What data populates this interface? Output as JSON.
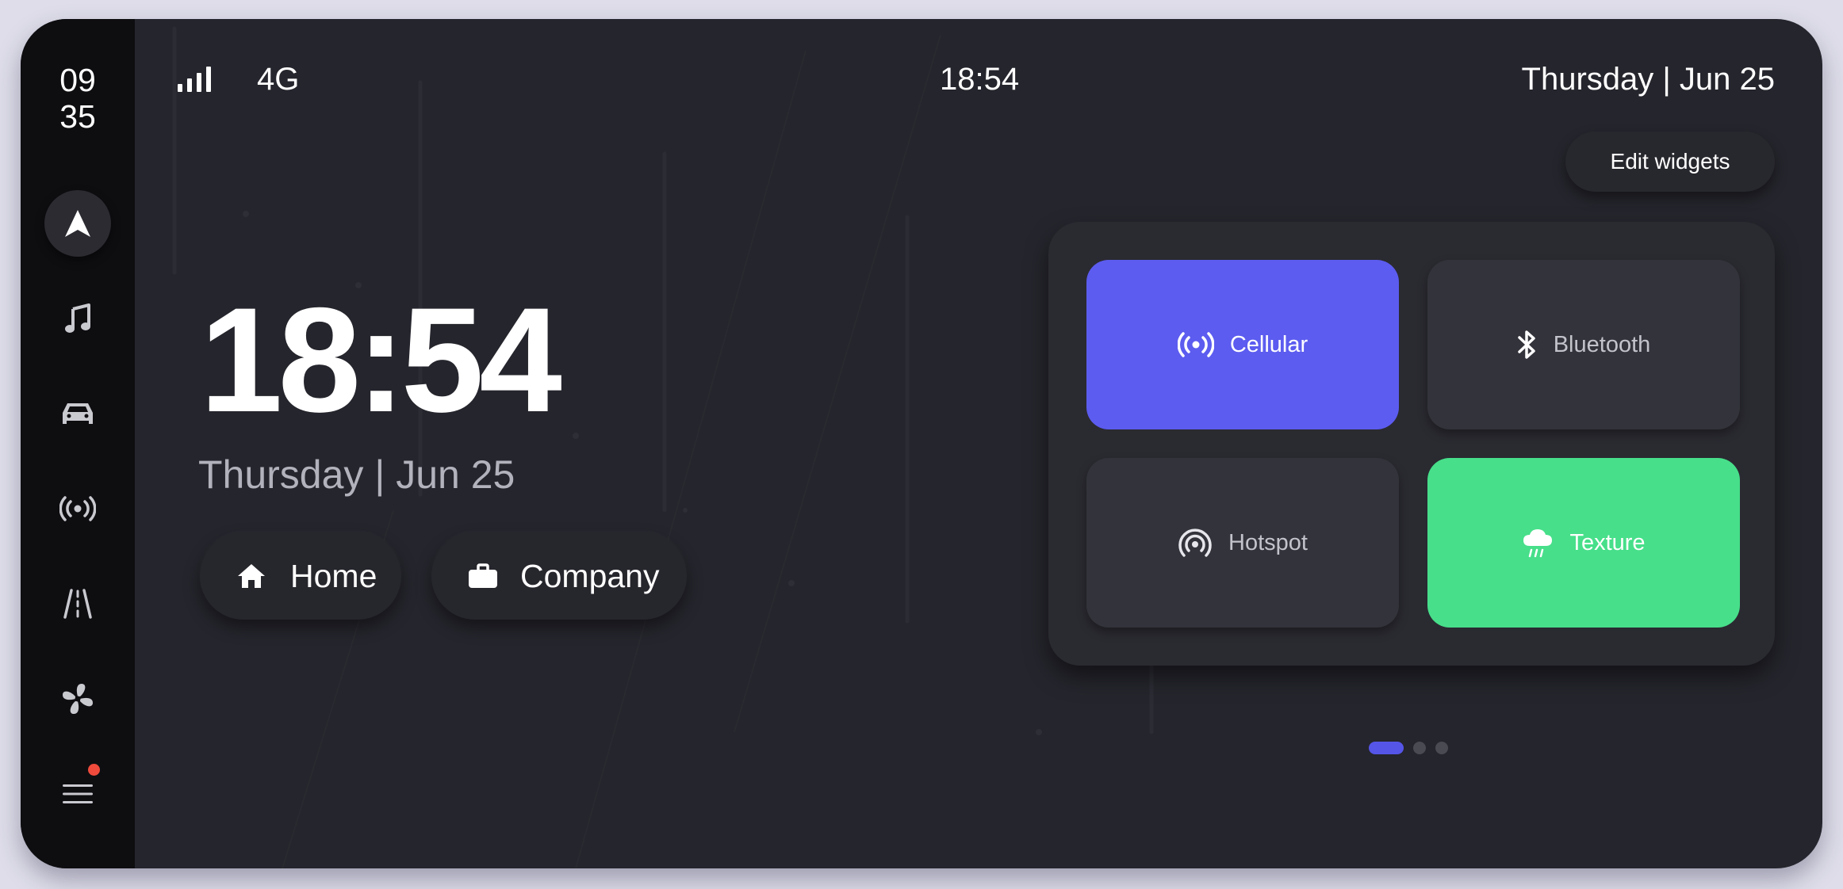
{
  "sidebar": {
    "clock_hours": "09",
    "clock_minutes": "35",
    "items": [
      {
        "name": "navigation",
        "icon": "navigation-arrow-icon",
        "active": true
      },
      {
        "name": "music",
        "icon": "music-note-icon",
        "active": false
      },
      {
        "name": "vehicle",
        "icon": "car-icon",
        "active": false
      },
      {
        "name": "broadcast",
        "icon": "broadcast-icon",
        "active": false
      },
      {
        "name": "road",
        "icon": "road-icon",
        "active": false
      },
      {
        "name": "climate",
        "icon": "fan-icon",
        "active": false
      },
      {
        "name": "menu",
        "icon": "menu-icon",
        "active": false,
        "notification": true
      }
    ]
  },
  "statusbar": {
    "signal_icon": "signal-bars-icon",
    "network": "4G",
    "time": "18:54",
    "date": "Thursday | Jun 25"
  },
  "main": {
    "time": "18:54",
    "date": "Thursday | Jun 25",
    "shortcuts": [
      {
        "label": "Home",
        "icon": "home-icon"
      },
      {
        "label": "Company",
        "icon": "briefcase-icon"
      }
    ]
  },
  "widgets": {
    "edit_label": "Edit widgets",
    "tiles": [
      {
        "label": "Cellular",
        "icon": "cellular-icon",
        "active": true,
        "color": "#5c5cf0"
      },
      {
        "label": "Bluetooth",
        "icon": "bluetooth-icon",
        "active": false
      },
      {
        "label": "Hotspot",
        "icon": "hotspot-icon",
        "active": false
      },
      {
        "label": "Texture",
        "icon": "rain-cloud-icon",
        "active": true,
        "color": "#47df8a"
      }
    ],
    "pagination": {
      "pages": 3,
      "current": 1
    }
  },
  "colors": {
    "accent": "#5c5cf0",
    "success": "#47df8a",
    "background": "#25252d",
    "sidebar": "#0e0e11",
    "notification": "#ef4a3c"
  }
}
